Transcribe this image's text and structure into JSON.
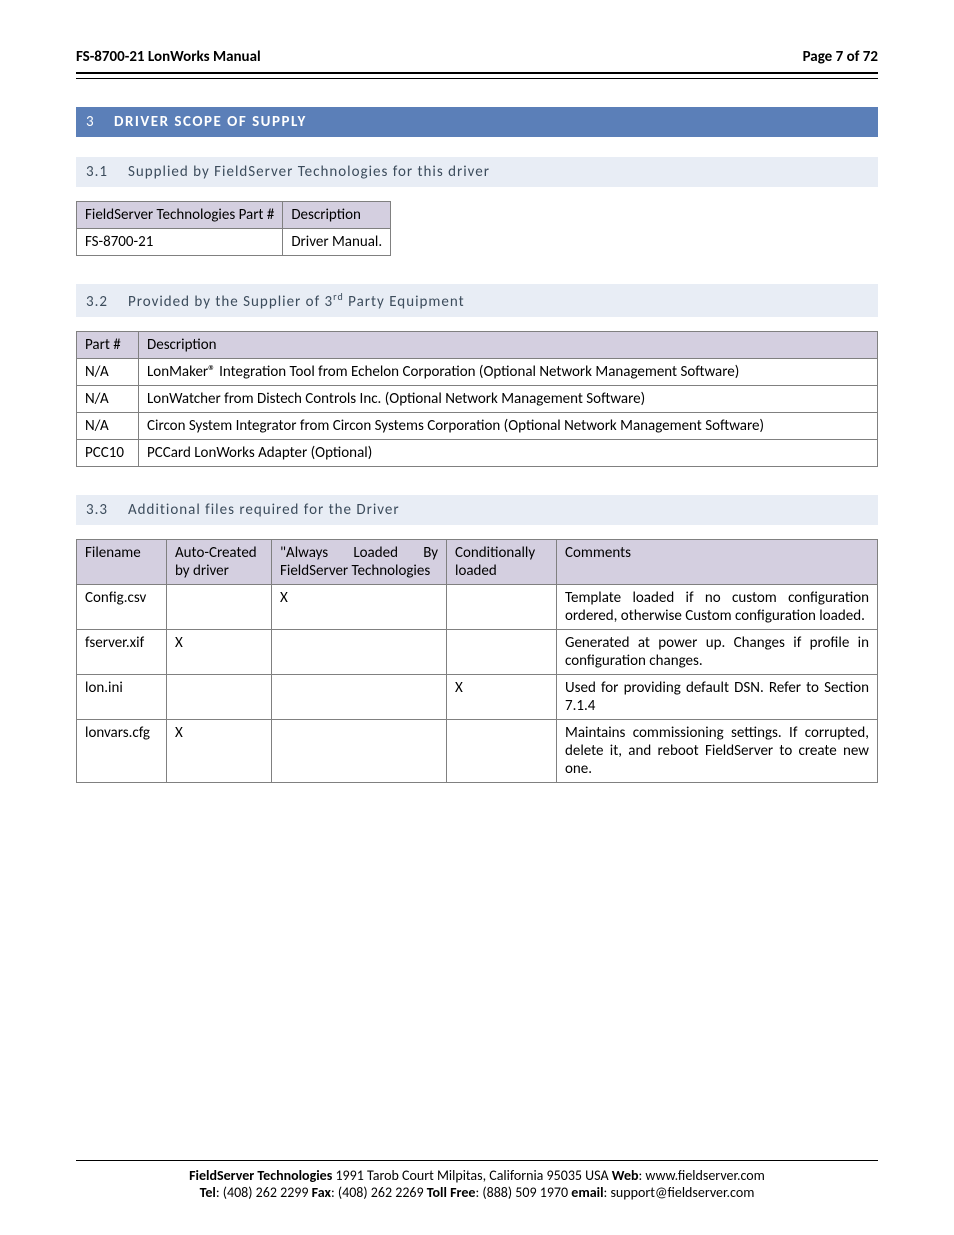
{
  "header": {
    "left": "FS-8700-21 LonWorks Manual",
    "right": "Page 7 of 72"
  },
  "section": {
    "num": "3",
    "title": "DRIVER SCOPE OF SUPPLY"
  },
  "sub1": {
    "num": "3.1",
    "title": "Supplied by FieldServer Technologies for this driver",
    "cols": [
      "FieldServer Technologies Part #",
      "Description"
    ],
    "rows": [
      [
        "FS-8700-21",
        "Driver Manual."
      ]
    ]
  },
  "sub2": {
    "num": "3.2",
    "title_a": "Provided by the Supplier of 3",
    "title_sup": "rd",
    "title_b": " Party Equipment",
    "cols": [
      "Part #",
      "Description"
    ],
    "rows": [
      [
        "N/A",
        "LonMaker® Integration Tool from Echelon Corporation (Optional Network Management Software)"
      ],
      [
        "N/A",
        "LonWatcher from Distech Controls Inc. (Optional Network Management Software)"
      ],
      [
        "N/A",
        "Circon System Integrator from Circon Systems Corporation (Optional Network Management Software)"
      ],
      [
        "PCC10",
        "PCCard LonWorks Adapter (Optional)"
      ]
    ]
  },
  "sub3": {
    "num": "3.3",
    "title": "Additional files required for the Driver",
    "cols": [
      "Filename",
      "Auto-Created by driver",
      "\"Always Loaded By FieldServer Technologies",
      "Conditionally loaded",
      "Comments"
    ],
    "rows": [
      [
        "Config.csv",
        "",
        "X",
        "",
        "Template loaded if no custom configuration ordered, otherwise Custom configuration loaded."
      ],
      [
        "fserver.xif",
        "X",
        "",
        "",
        "Generated at power up. Changes if profile in configuration changes."
      ],
      [
        "lon.ini",
        "",
        "",
        "X",
        "Used for providing default DSN. Refer to Section 7.1.4"
      ],
      [
        "lonvars.cfg",
        "X",
        "",
        "",
        "Maintains commissioning settings. If corrupted, delete it, and reboot FieldServer to create new one."
      ]
    ]
  },
  "footer": {
    "company": "FieldServer Technologies",
    "address": " 1991 Tarob Court Milpitas, California 95035 USA   ",
    "web_lbl": "Web",
    "web": ": www.fieldserver.com",
    "tel_lbl": "Tel",
    "tel": ": (408) 262 2299   ",
    "fax_lbl": "Fax",
    "fax": ": (408) 262 2269   ",
    "toll_lbl": "Toll Free",
    "toll": ": (888) 509 1970   ",
    "email_lbl": "email",
    "email": ": support@fieldserver.com"
  }
}
